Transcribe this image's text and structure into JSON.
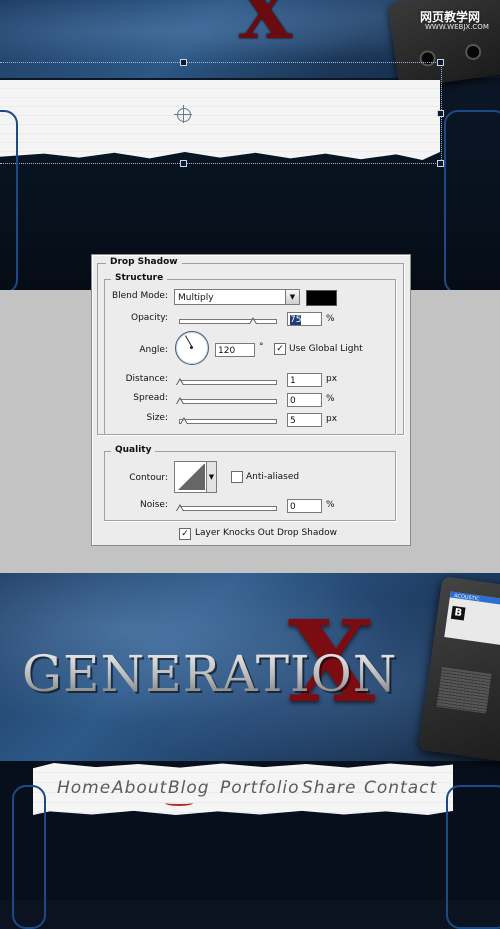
{
  "watermark": {
    "title": "网页教学网",
    "url": "WWW.WEBJX.COM"
  },
  "dialog": {
    "title": "Drop Shadow",
    "structure": {
      "legend": "Structure",
      "blend_mode_label": "Blend Mode:",
      "blend_mode_value": "Multiply",
      "color": "#000000",
      "opacity_label": "Opacity:",
      "opacity_value": "75",
      "opacity_unit": "%",
      "angle_label": "Angle:",
      "angle_value": "120",
      "angle_unit": "°",
      "global_light_label": "Use Global Light",
      "global_light_checked": true,
      "distance_label": "Distance:",
      "distance_value": "1",
      "distance_unit": "px",
      "spread_label": "Spread:",
      "spread_value": "0",
      "spread_unit": "%",
      "size_label": "Size:",
      "size_value": "5",
      "size_unit": "px"
    },
    "quality": {
      "legend": "Quality",
      "contour_label": "Contour:",
      "anti_aliased_label": "Anti-aliased",
      "anti_aliased_checked": false,
      "noise_label": "Noise:",
      "noise_value": "0",
      "noise_unit": "%"
    },
    "knockout_label": "Layer Knocks Out Drop Shadow",
    "knockout_checked": true
  },
  "preview": {
    "logo_text": "GENERATION",
    "logo_x": "X",
    "top_x": "X",
    "cassette_brand": "ACOUSTIC",
    "cassette_side": "B",
    "nav": [
      "Home",
      "About",
      "Blog",
      "Portfolio",
      "Share",
      "Contact"
    ]
  },
  "colors": {
    "banner_blue": "#2c5784",
    "logo_red": "#7a0c12",
    "frame_blue": "#1c4a86",
    "dialog_bg": "#ececec",
    "band_gray": "#c3c3c3"
  }
}
